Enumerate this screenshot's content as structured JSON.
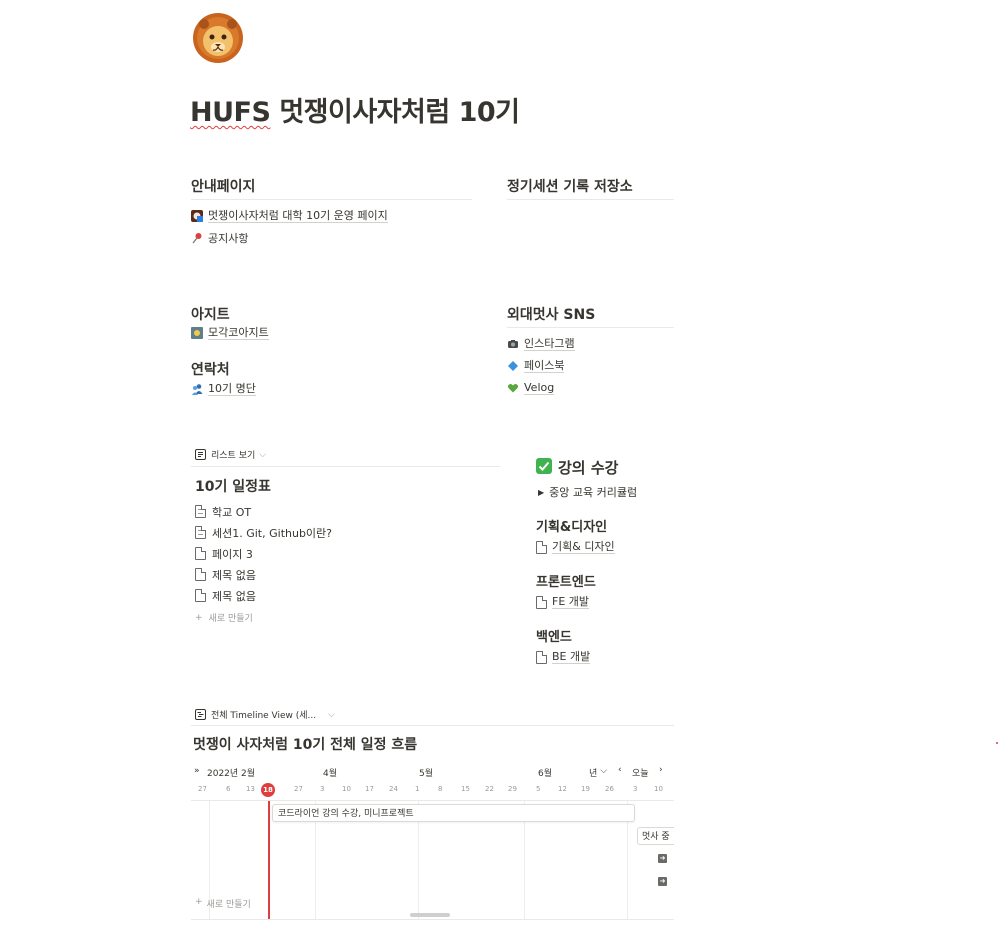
{
  "page": {
    "title_prefix": "HUFS",
    "title_rest": " 멋쟁이사자처럼 10기"
  },
  "sections": {
    "guide": {
      "heading": "안내페이지",
      "links": [
        "멋쟁이사자처럼 대학 10기 운영 페이지",
        "공지사항"
      ]
    },
    "sessions": {
      "heading": "정기세션 기록 저장소"
    },
    "agit": {
      "heading": "아지트",
      "links": [
        "모각코아지트"
      ]
    },
    "contact": {
      "heading": "연락처",
      "links": [
        "10기 명단"
      ]
    },
    "sns": {
      "heading": "외대멋사 SNS",
      "links": [
        "인스타그램",
        "페이스북",
        "Velog"
      ]
    }
  },
  "schedule": {
    "view_label": "리스트 보기",
    "title": "10기 일정표",
    "items": [
      "학교 OT",
      "세션1. Git, Github이란?",
      "페이지 3",
      "제목 없음",
      "제목 없음"
    ],
    "new_label": "새로 만들기"
  },
  "courses": {
    "heading": "강의 수강",
    "toggle": "중앙 교육 커리큘럼",
    "groups": [
      {
        "heading": "기획&디자인",
        "link": "기획& 디자인"
      },
      {
        "heading": "프론트엔드",
        "link": "FE 개발"
      },
      {
        "heading": "백엔드",
        "link": "BE 개발"
      }
    ]
  },
  "timeline": {
    "view_label": "전체 Timeline View (세...",
    "title": "멋쟁이 사자처럼 10기 전체 일정 흐름",
    "nav": {
      "expand": "»",
      "year_label": "2022년 2월",
      "scale": "년",
      "today": "오늘"
    },
    "months": [
      "4월",
      "5월",
      "6월"
    ],
    "days": [
      "27",
      "6",
      "13",
      "18",
      "27",
      "3",
      "10",
      "17",
      "24",
      "1",
      "8",
      "15",
      "22",
      "29",
      "5",
      "12",
      "19",
      "26",
      "3",
      "10"
    ],
    "today_day": "18",
    "bar_label": "코드라이언 강의 수강, 미니프로젝트",
    "side_label": "멋사 중",
    "new_label": "새로 만들기"
  }
}
